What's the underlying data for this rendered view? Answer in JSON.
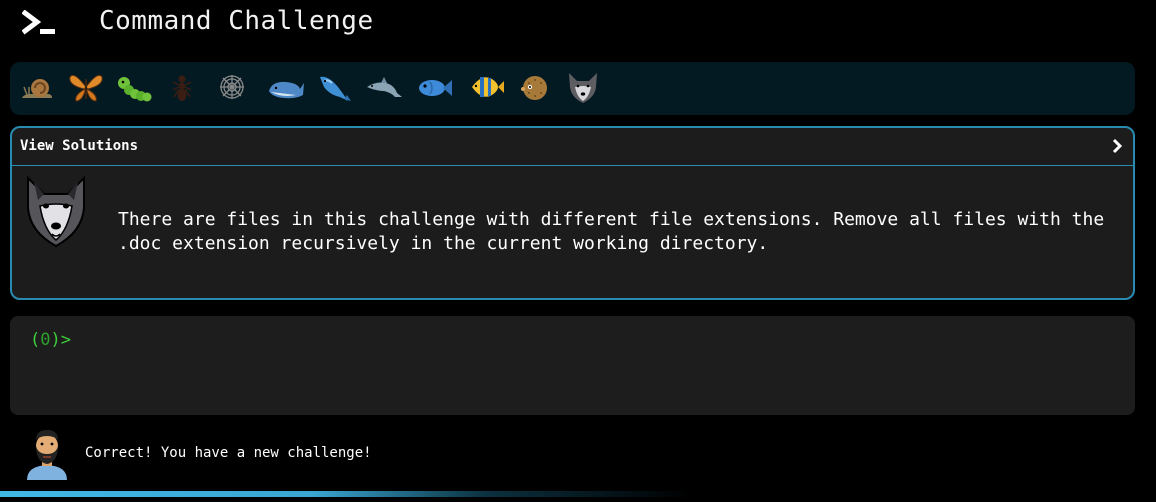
{
  "app": {
    "title": "Command Challenge",
    "logo_icon": "terminal-prompt-icon"
  },
  "animals": [
    {
      "name": "snail",
      "icon": "snail-icon"
    },
    {
      "name": "butterfly",
      "icon": "butterfly-icon"
    },
    {
      "name": "caterpillar",
      "icon": "caterpillar-icon"
    },
    {
      "name": "ant",
      "icon": "ant-icon"
    },
    {
      "name": "spider-web",
      "icon": "spider-web-icon"
    },
    {
      "name": "whale",
      "icon": "whale-icon"
    },
    {
      "name": "spouting-whale",
      "icon": "spouting-whale-icon"
    },
    {
      "name": "dolphin",
      "icon": "dolphin-icon"
    },
    {
      "name": "fish",
      "icon": "fish-icon"
    },
    {
      "name": "tropical-fish",
      "icon": "tropical-fish-icon"
    },
    {
      "name": "blowfish",
      "icon": "blowfish-icon"
    },
    {
      "name": "wolf",
      "icon": "wolf-icon"
    }
  ],
  "solutions": {
    "label": "View Solutions",
    "chevron": "›",
    "avatar_icon": "wolf-icon",
    "challenge_text": "There are files in this challenge with different file extensions. Remove all files with the .doc extension recursively in the current working directory."
  },
  "terminal": {
    "prompt_open": "(",
    "prompt_count": "0",
    "prompt_close": ")>",
    "input_value": ""
  },
  "feedback": {
    "avatar_icon": "bearded-man-icon",
    "message": "Correct! You have a new challenge!"
  },
  "progress": {
    "fraction": 0.6
  },
  "colors": {
    "accent": "#2a8bb0",
    "prompt_green": "#3ccf3c",
    "panel_bg": "#1c1c1c",
    "animal_bar_bg": "#041a22"
  }
}
